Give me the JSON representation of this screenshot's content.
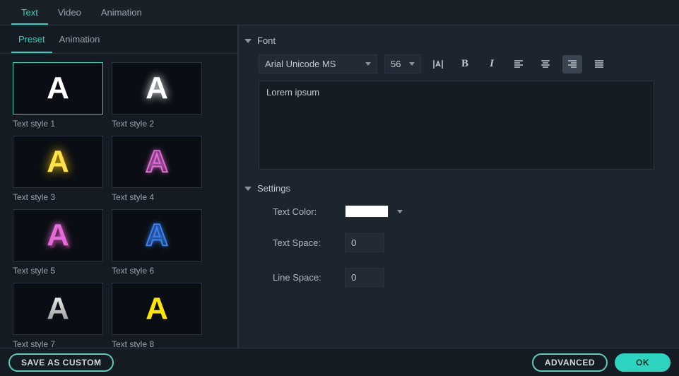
{
  "topTabs": {
    "text": "Text",
    "video": "Video",
    "animation": "Animation"
  },
  "subTabs": {
    "preset": "Preset",
    "animation": "Animation"
  },
  "presets": {
    "s1": "Text style 1",
    "s2": "Text style 2",
    "s3": "Text style 3",
    "s4": "Text style 4",
    "s5": "Text style 5",
    "s6": "Text style 6",
    "s7": "Text style 7",
    "s8": "Text style 8"
  },
  "font": {
    "section": "Font",
    "family": "Arial Unicode MS",
    "size": "56",
    "textValue": "Lorem ipsum"
  },
  "settings": {
    "section": "Settings",
    "textColorLabel": "Text Color:",
    "textColor": "#ffffff",
    "textSpaceLabel": "Text Space:",
    "textSpace": "0",
    "lineSpaceLabel": "Line Space:",
    "lineSpace": "0"
  },
  "footer": {
    "saveCustom": "SAVE AS CUSTOM",
    "advanced": "ADVANCED",
    "ok": "OK"
  }
}
